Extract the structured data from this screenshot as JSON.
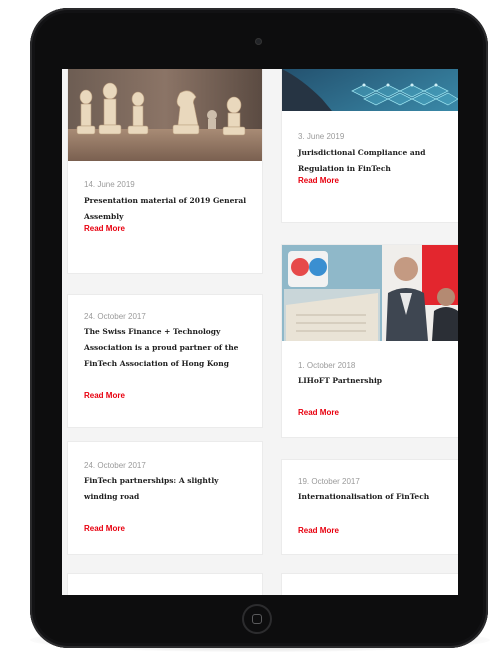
{
  "cards": [
    {
      "date": "14. June 2019",
      "title": "Presentation material of 2019 General Assembly",
      "read_more": "Read More",
      "image": "chess-pieces"
    },
    {
      "date": "3. June 2019",
      "title": "Jurisdictional Compliance and Regulation in FinTech",
      "read_more": "Read More",
      "image": "city-network"
    },
    {
      "date": "24. October 2017",
      "title": "The Swiss Finance + Technology Association is a proud partner of the FinTech Association of Hong Kong",
      "read_more": "Read More"
    },
    {
      "date": "1. October 2018",
      "title": "LIHoFT Partnership",
      "read_more": "Read More",
      "image": "event-booth"
    },
    {
      "date": "24. October 2017",
      "title": "FinTech partnerships: A slightly winding road",
      "read_more": "Read More"
    },
    {
      "date": "19. October 2017",
      "title": "Internationalisation of FinTech",
      "read_more": "Read More"
    }
  ],
  "colors": {
    "accent": "#e8000f",
    "bezel": "#0d0d0e",
    "background": "#f4f4f4"
  }
}
